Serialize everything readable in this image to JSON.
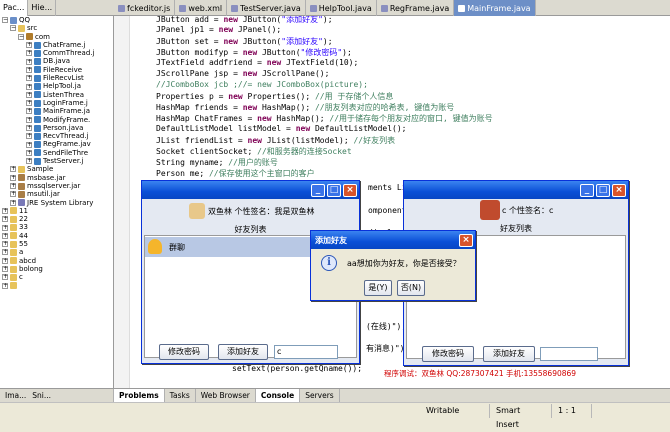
{
  "left_tabs": [
    {
      "label": "Pac..."
    },
    {
      "label": "Hie..."
    }
  ],
  "tree": [
    {
      "label": "QQ",
      "indent": 0,
      "kind": "project",
      "twisty": "−"
    },
    {
      "label": "src",
      "indent": 1,
      "kind": "folder",
      "twisty": "−"
    },
    {
      "label": "com",
      "indent": 2,
      "kind": "pkg",
      "twisty": "−"
    },
    {
      "label": "ChatFrame.j",
      "indent": 3,
      "kind": "java",
      "twisty": "+"
    },
    {
      "label": "CommThread.j",
      "indent": 3,
      "kind": "java",
      "twisty": "+"
    },
    {
      "label": "DB.java",
      "indent": 3,
      "kind": "java",
      "twisty": "+"
    },
    {
      "label": "FileReceive",
      "indent": 3,
      "kind": "java",
      "twisty": "+"
    },
    {
      "label": "FileRecvList",
      "indent": 3,
      "kind": "java",
      "twisty": "+"
    },
    {
      "label": "HelpTool.ja",
      "indent": 3,
      "kind": "java",
      "twisty": "+"
    },
    {
      "label": "ListenThrea",
      "indent": 3,
      "kind": "java",
      "twisty": "+"
    },
    {
      "label": "LoginFrame.j",
      "indent": 3,
      "kind": "java",
      "twisty": "+"
    },
    {
      "label": "MainFrame.ja",
      "indent": 3,
      "kind": "java",
      "twisty": "+"
    },
    {
      "label": "ModifyFrame.",
      "indent": 3,
      "kind": "java",
      "twisty": "+"
    },
    {
      "label": "Person.java",
      "indent": 3,
      "kind": "java",
      "twisty": "+"
    },
    {
      "label": "RecvThread.j",
      "indent": 3,
      "kind": "java",
      "twisty": "+"
    },
    {
      "label": "RegFrame.jav",
      "indent": 3,
      "kind": "java",
      "twisty": "+"
    },
    {
      "label": "SendFileThre",
      "indent": 3,
      "kind": "java",
      "twisty": "+"
    },
    {
      "label": "TestServer.j",
      "indent": 3,
      "kind": "java",
      "twisty": "+"
    },
    {
      "label": "Sample",
      "indent": 1,
      "kind": "folder",
      "twisty": "+"
    },
    {
      "label": "msbase.jar",
      "indent": 1,
      "kind": "jar",
      "twisty": "+"
    },
    {
      "label": "mssqlserver.jar",
      "indent": 1,
      "kind": "jar",
      "twisty": "+"
    },
    {
      "label": "msutil.jar",
      "indent": 1,
      "kind": "jar",
      "twisty": "+"
    },
    {
      "label": "JRE System Library",
      "indent": 1,
      "kind": "lib",
      "twisty": "+"
    },
    {
      "label": "11",
      "indent": 0,
      "kind": "folder",
      "twisty": "+"
    },
    {
      "label": "22",
      "indent": 0,
      "kind": "folder",
      "twisty": "+"
    },
    {
      "label": "33",
      "indent": 0,
      "kind": "folder",
      "twisty": "+"
    },
    {
      "label": "44",
      "indent": 0,
      "kind": "folder",
      "twisty": "+"
    },
    {
      "label": "55",
      "indent": 0,
      "kind": "folder",
      "twisty": "+"
    },
    {
      "label": "a",
      "indent": 0,
      "kind": "folder",
      "twisty": "+"
    },
    {
      "label": "abcd",
      "indent": 0,
      "kind": "folder",
      "twisty": "+"
    },
    {
      "label": "bolong",
      "indent": 0,
      "kind": "folder",
      "twisty": "+"
    },
    {
      "label": "c",
      "indent": 0,
      "kind": "folder",
      "twisty": "+"
    },
    {
      "label": "",
      "indent": 0,
      "kind": "folder",
      "twisty": "+"
    }
  ],
  "editor_tabs": [
    {
      "label": "fckeditor.js",
      "active": false
    },
    {
      "label": "web.xml",
      "active": false
    },
    {
      "label": "TestServer.java",
      "active": false
    },
    {
      "label": "HelpTool.java",
      "active": false
    },
    {
      "label": "RegFrame.java",
      "active": false
    },
    {
      "label": "MainFrame.java",
      "active": true
    }
  ],
  "code_lines": [
    [
      {
        "t": "JButton add = ",
        "c": ""
      },
      {
        "t": "new",
        "c": "kw"
      },
      {
        "t": " JButton(",
        "c": ""
      },
      {
        "t": "\"添加好友\"",
        "c": "str"
      },
      {
        "t": ");",
        "c": ""
      }
    ],
    [
      {
        "t": "JPanel jp1 = ",
        "c": ""
      },
      {
        "t": "new",
        "c": "kw"
      },
      {
        "t": " JPanel();",
        "c": ""
      }
    ],
    [
      {
        "t": "JButton set = ",
        "c": ""
      },
      {
        "t": "new",
        "c": "kw"
      },
      {
        "t": " JButton(",
        "c": ""
      },
      {
        "t": "\"添加好友\"",
        "c": "str"
      },
      {
        "t": ");",
        "c": ""
      }
    ],
    [
      {
        "t": "JButton modifyp = ",
        "c": ""
      },
      {
        "t": "new",
        "c": "kw"
      },
      {
        "t": " JButton(",
        "c": ""
      },
      {
        "t": "\"修改密码\"",
        "c": "str"
      },
      {
        "t": ");",
        "c": ""
      }
    ],
    [
      {
        "t": "JTextField addfriend = ",
        "c": ""
      },
      {
        "t": "new",
        "c": "kw"
      },
      {
        "t": " JTextField(10);",
        "c": ""
      }
    ],
    [
      {
        "t": "JScrollPane jsp = ",
        "c": ""
      },
      {
        "t": "new",
        "c": "kw"
      },
      {
        "t": " JScrollPane();",
        "c": ""
      }
    ],
    [
      {
        "t": "//JComboBox jcb ;//= new JComboBox(picture);",
        "c": "cm"
      }
    ],
    [
      {
        "t": "Properties p = ",
        "c": ""
      },
      {
        "t": "new",
        "c": "kw"
      },
      {
        "t": " Properties(); ",
        "c": ""
      },
      {
        "t": "//用 于存储个人信息",
        "c": "cm"
      }
    ],
    [
      {
        "t": "HashMap friends = ",
        "c": ""
      },
      {
        "t": "new",
        "c": "kw"
      },
      {
        "t": " HashMap(); ",
        "c": ""
      },
      {
        "t": "//朋友列表对应的哈希表, 键值为账号",
        "c": "cm"
      }
    ],
    [
      {
        "t": "HashMap ChatFrames = ",
        "c": ""
      },
      {
        "t": "new",
        "c": "kw"
      },
      {
        "t": " HashMap(); ",
        "c": ""
      },
      {
        "t": "//用于储存每个朋友对应的窗口, 键值为账号",
        "c": "cm"
      }
    ],
    [
      {
        "t": "DefaultListModel listModel = ",
        "c": ""
      },
      {
        "t": "new",
        "c": "kw"
      },
      {
        "t": " DefaultListModel();",
        "c": ""
      }
    ],
    [
      {
        "t": "JList friendList = ",
        "c": ""
      },
      {
        "t": "new",
        "c": "kw"
      },
      {
        "t": " JList(listModel); ",
        "c": ""
      },
      {
        "t": "//好友列表",
        "c": "cm"
      }
    ],
    [
      {
        "t": "Socket clientSocket; ",
        "c": ""
      },
      {
        "t": "//和服务器的连接Socket",
        "c": "cm"
      }
    ],
    [
      {
        "t": "String myname; ",
        "c": ""
      },
      {
        "t": "//用户的账号",
        "c": "cm"
      }
    ],
    [
      {
        "t": "Person me; ",
        "c": ""
      },
      {
        "t": "//保存使用这个主窗口的客户",
        "c": "cm"
      }
    ]
  ],
  "code_fragments": [
    "ments Li",
    "omponent",
    "c",
    "displa",
    "(在线)\");",
    "有消息)\");",
    "setText(person.getQname());"
  ],
  "window1": {
    "signature": "双鱼林 个性签名：我是双鱼林",
    "list_title": "好友列表",
    "group_label": "群聊",
    "modify_label": "修改密码",
    "add_label": "添加好友",
    "input_value": "c",
    "min": "_",
    "max": "□",
    "close": "×"
  },
  "window2": {
    "signature": "c 个性签名：c",
    "list_title": "好友列表",
    "modify_label": "修改密码",
    "add_label": "添加好友",
    "input_value": "",
    "min": "_",
    "max": "□",
    "close": "×"
  },
  "dialog": {
    "title": "添加好友",
    "message": "aa想加你为好友，你是否接受？",
    "yes_label": "是(Y)",
    "no_label": "否(N)",
    "info_glyph": "i",
    "close": "×"
  },
  "caption": "程序调试：双鱼林 QQ:287307421 手机:13558690869",
  "bottom_tabs": [
    {
      "label": "Problems",
      "active": true
    },
    {
      "label": "Tasks",
      "active": false
    },
    {
      "label": "Web Browser",
      "active": false
    },
    {
      "label": "Console",
      "active": true
    },
    {
      "label": "Servers",
      "active": false
    }
  ],
  "status": {
    "writable": "Writable",
    "insert": "Smart Insert",
    "position": "1 : 1"
  },
  "left_bottom_tabs": [
    {
      "label": "Ima..."
    },
    {
      "label": "Sni..."
    }
  ],
  "colors": {
    "title_blue": "#0a4fd6",
    "caption_red": "#d00000",
    "keyword": "#7f0055",
    "comment": "#3f7f5f",
    "string": "#2a00ff"
  }
}
